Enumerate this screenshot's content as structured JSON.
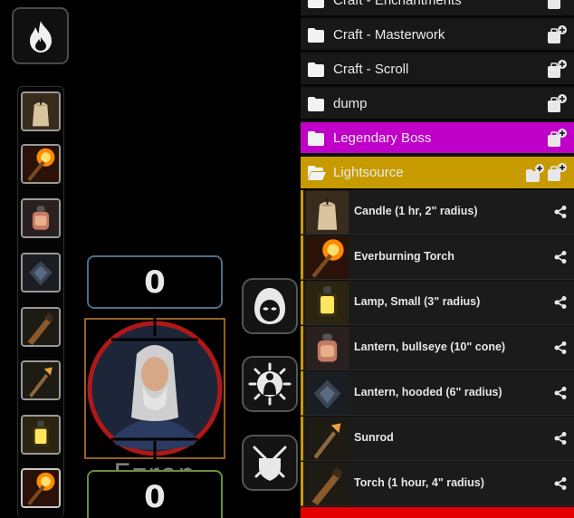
{
  "hud": {
    "token_name": "Ezren",
    "bar_top_value": "0",
    "bar_bottom_value": "0",
    "quickbar_items": [
      "candle",
      "everburning-torch",
      "lantern-bullseye",
      "lantern-hooded",
      "torch",
      "sunrod",
      "lamp-small",
      "everburning-torch"
    ]
  },
  "folders": [
    {
      "label": "Craft - Enchantments"
    },
    {
      "label": "Craft - Masterwork"
    },
    {
      "label": "Craft - Scroll"
    },
    {
      "label": "dump"
    },
    {
      "label": "Legendary Boss",
      "color": "#c000c8"
    },
    {
      "label": "Lightsource",
      "color": "#c79b00"
    }
  ],
  "items": [
    {
      "label": "Candle (1 hr, 2\" radius)",
      "icon": "candle"
    },
    {
      "label": "Everburning Torch",
      "icon": "everburning-torch"
    },
    {
      "label": "Lamp, Small (3\" radius)",
      "icon": "lamp"
    },
    {
      "label": "Lantern, bullseye (10\" cone)",
      "icon": "lantern-bullseye"
    },
    {
      "label": "Lantern, hooded (6\" radius)",
      "icon": "lantern-hooded"
    },
    {
      "label": "Sunrod",
      "icon": "sunrod"
    },
    {
      "label": "Torch (1 hour, 4\" radius)",
      "icon": "torch"
    }
  ]
}
